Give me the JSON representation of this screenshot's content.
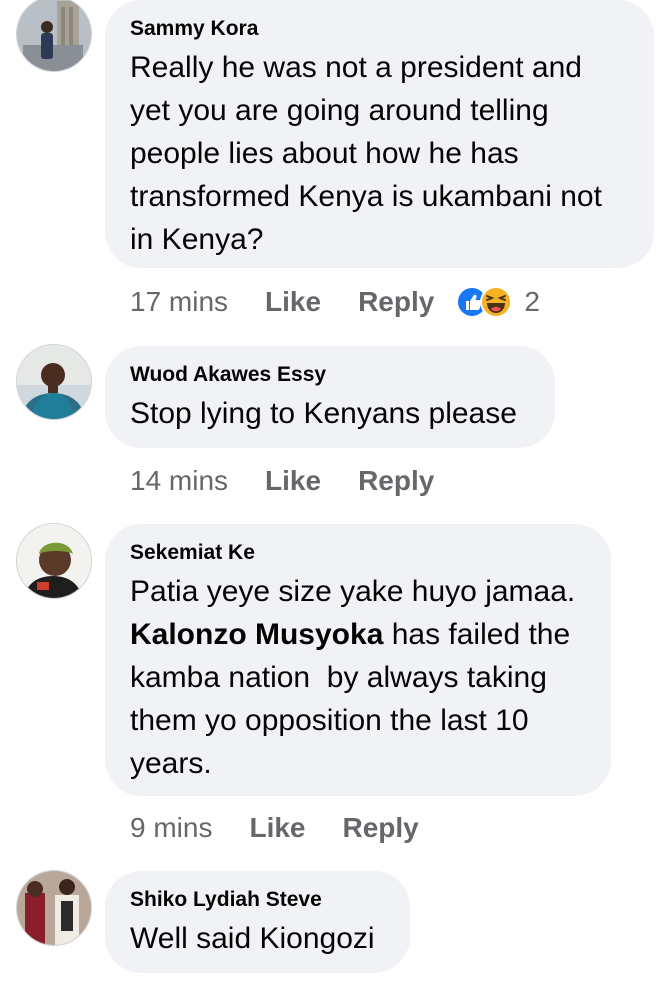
{
  "comments": [
    {
      "author": "Sammy Kora",
      "text_lines": [
        "Really he was not a president and",
        "yet you are going around telling",
        "people lies about how he has",
        "transformed Kenya is ukambani not",
        "in Kenya?"
      ],
      "time": "17 mins",
      "like_label": "Like",
      "reply_label": "Reply",
      "reaction_count": "2",
      "reaction_icons": [
        "like-reaction-icon",
        "haha-reaction-icon"
      ]
    },
    {
      "author": "Wuod Akawes Essy",
      "text_lines": [
        "Stop lying to Kenyans please"
      ],
      "time": "14 mins",
      "like_label": "Like",
      "reply_label": "Reply"
    },
    {
      "author": "Sekemiat Ke",
      "text_line1": "Patia yeye size yake huyo jamaa.",
      "mention": "Kalonzo Musyoka",
      "text_line2_rest": " has failed the",
      "text_lines_rest": [
        "kamba nation  by always taking",
        "them yo opposition the last 10",
        "years."
      ],
      "time": "9 mins",
      "like_label": "Like",
      "reply_label": "Reply"
    },
    {
      "author": "Shiko Lydiah Steve",
      "text_lines": [
        "Well said Kiongozi"
      ]
    }
  ],
  "colors": {
    "bubble": "#f0f2f5",
    "meta_text": "#65676b",
    "like_blue": "#1877f2",
    "haha_yellow": "#f7b125"
  }
}
